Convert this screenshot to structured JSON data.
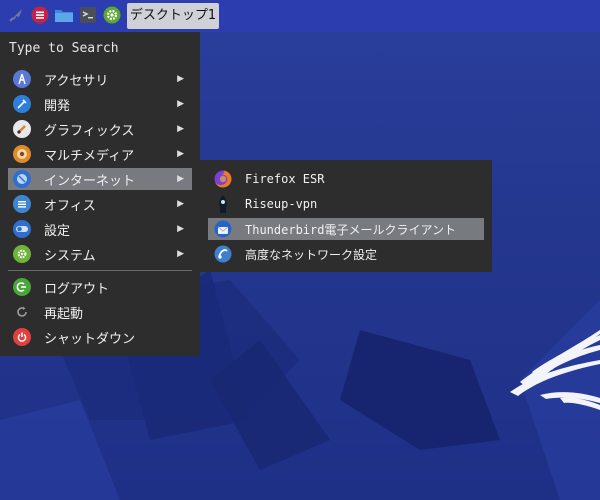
{
  "taskbar": {
    "workspace_label": "デスクトップ1",
    "icons": [
      "rocket-icon",
      "menu-icon",
      "folder-icon",
      "terminal-icon",
      "settings-icon"
    ]
  },
  "menu": {
    "search_placeholder": "Type to Search",
    "items": [
      {
        "label": "アクセサリ",
        "icon": "accessories-icon",
        "color": "#5a78d6",
        "arrow": "▶"
      },
      {
        "label": "開発",
        "icon": "development-icon",
        "color": "#2f7fd8",
        "arrow": "▶"
      },
      {
        "label": "グラフィックス",
        "icon": "graphics-icon",
        "color": "#e8e8e8",
        "arrow": "▶"
      },
      {
        "label": "マルチメディア",
        "icon": "multimedia-icon",
        "color": "#e08a2a",
        "arrow": "▶"
      },
      {
        "label": "インターネット",
        "icon": "internet-icon",
        "color": "#2f6fcf",
        "arrow": "▶"
      },
      {
        "label": "オフィス",
        "icon": "office-icon",
        "color": "#3f86d0",
        "arrow": "▶"
      },
      {
        "label": "設定",
        "icon": "settings-icon",
        "color": "#2f6fd0",
        "arrow": "▶"
      },
      {
        "label": "システム",
        "icon": "system-icon",
        "color": "#6fb43a",
        "arrow": "▶"
      }
    ],
    "actions": [
      {
        "label": "ログアウト",
        "icon": "logout-icon",
        "color": "#4aa53a"
      },
      {
        "label": "再起動",
        "icon": "reboot-icon",
        "color": "#9a9a9a"
      },
      {
        "label": "シャットダウン",
        "icon": "power-icon",
        "color": "#e04040"
      }
    ]
  },
  "submenu": {
    "items": [
      {
        "label": "Firefox ESR",
        "icon": "firefox-icon"
      },
      {
        "label": "Riseup-vpn",
        "icon": "riseup-vpn-icon"
      },
      {
        "label": "Thunderbird電子メールクライアント",
        "icon": "thunderbird-icon"
      },
      {
        "label": "高度なネットワーク設定",
        "icon": "network-settings-icon"
      }
    ]
  }
}
